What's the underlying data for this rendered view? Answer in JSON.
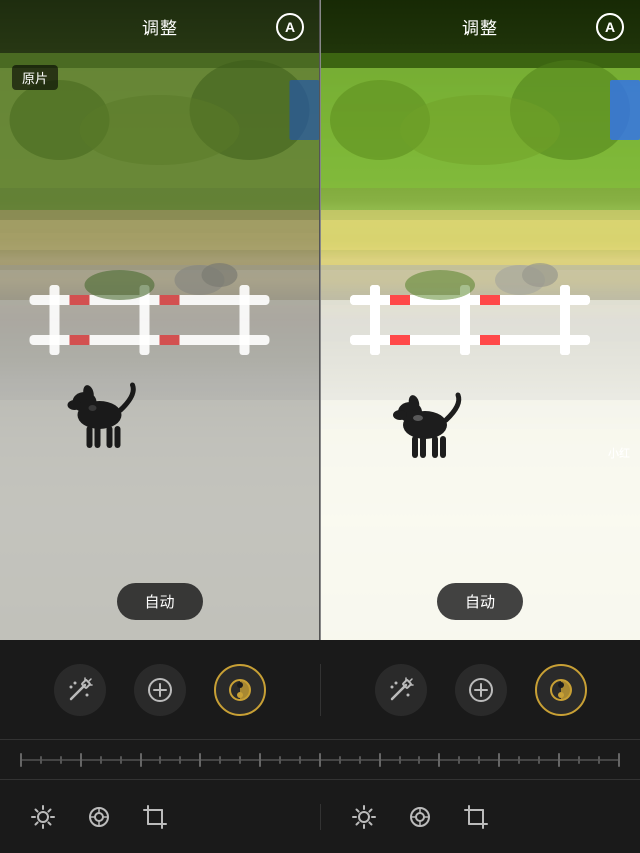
{
  "left_header": {
    "title": "调整",
    "icon_label": "A"
  },
  "right_header": {
    "title": "调整",
    "icon_label": "A"
  },
  "original_label": "原片",
  "auto_button_label": "自动",
  "watermark": "小红",
  "tools": {
    "left": [
      {
        "id": "magic-wand",
        "label": "magic-wand",
        "active": false
      },
      {
        "id": "plus-circle",
        "label": "plus-circle",
        "active": false
      },
      {
        "id": "tone-curve",
        "label": "tone-curve",
        "active": true
      }
    ],
    "right": [
      {
        "id": "magic-wand-r",
        "label": "magic-wand",
        "active": false
      },
      {
        "id": "plus-circle-r",
        "label": "plus-circle",
        "active": false
      },
      {
        "id": "tone-curve-r",
        "label": "tone-curve",
        "active": true
      }
    ]
  },
  "adj_icons": {
    "left": [
      "brightness",
      "retouch",
      "crop"
    ],
    "right": [
      "brightness",
      "retouch",
      "crop"
    ]
  },
  "colors": {
    "background": "#1a1a1a",
    "gold": "#c8a035",
    "panel_divider": "#888",
    "icon_color": "#bbbbbb",
    "header_bg": "rgba(0,0,0,0.5)",
    "auto_btn_bg": "rgba(30,30,30,0.85)"
  }
}
